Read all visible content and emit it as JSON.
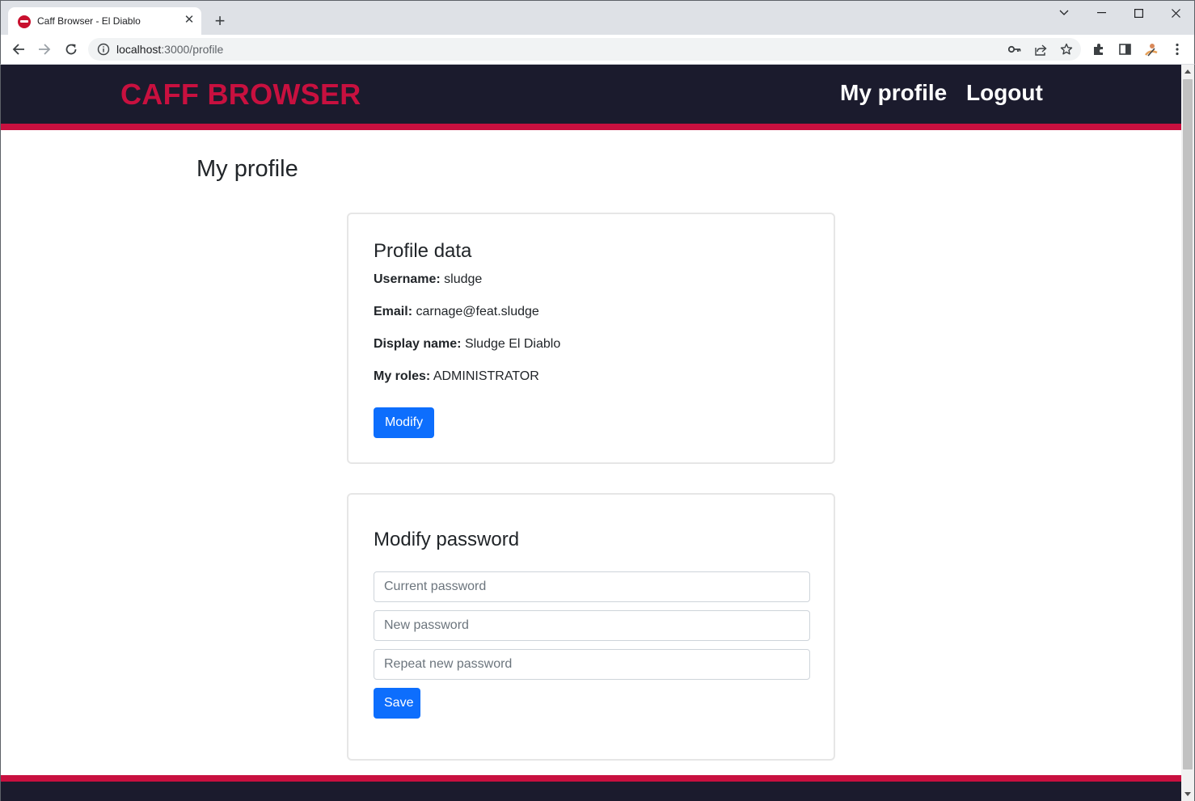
{
  "browser": {
    "tab_title": "Caff Browser - El Diablo",
    "url_host": "localhost",
    "url_rest": ":3000/profile"
  },
  "navbar": {
    "brand": "CAFF BROWSER",
    "profile_link": "My profile",
    "logout_link": "Logout"
  },
  "page": {
    "title": "My profile"
  },
  "profile_card": {
    "title": "Profile data",
    "fields": [
      {
        "label": "Username:",
        "value": "sludge"
      },
      {
        "label": "Email:",
        "value": "carnage@feat.sludge"
      },
      {
        "label": "Display name:",
        "value": "Sludge El Diablo"
      },
      {
        "label": "My roles:",
        "value": "ADMINISTRATOR"
      }
    ],
    "modify_label": "Modify"
  },
  "password_card": {
    "title": "Modify password",
    "current_placeholder": "Current password",
    "new_placeholder": "New password",
    "repeat_placeholder": "Repeat new password",
    "save_label": "Save"
  },
  "colors": {
    "brand": "#c8103f",
    "navbar_bg": "#1b1b2d",
    "primary_button": "#0d6efd"
  }
}
